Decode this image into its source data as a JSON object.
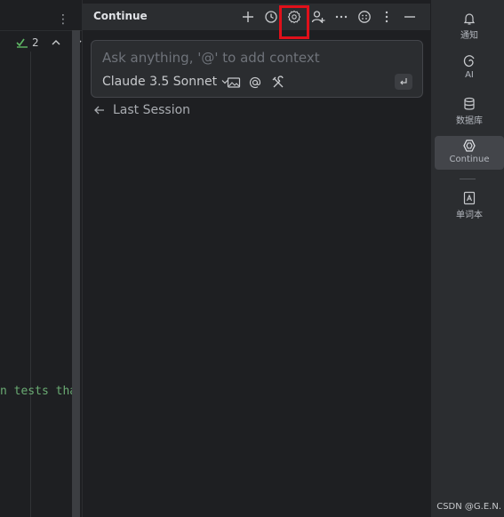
{
  "editor": {
    "kebab_icon": "more-vertical-icon",
    "inspection_count": "2",
    "code_snippet": "n tests tha",
    "colors": {
      "code_string": "#6aab73",
      "inspection_ok": "#5fb865"
    }
  },
  "panel": {
    "title": "Continue",
    "header_icons": [
      "plus-icon",
      "history-icon",
      "gear-icon",
      "person-add-icon",
      "ellipsis-icon",
      "emoji-icon",
      "more-vertical-icon",
      "minimize-icon"
    ],
    "highlight_color": "#e0101a",
    "input": {
      "placeholder": "Ask anything, '@' to add context",
      "model": "Claude 3.5 Sonnet",
      "icons": [
        "image-icon",
        "at-mention-icon",
        "tools-icon",
        "enter-icon"
      ]
    },
    "last_session_label": "Last Session"
  },
  "toolstrip": {
    "items": [
      {
        "label": "通知",
        "icon": "bell-icon",
        "active": false
      },
      {
        "label": "AI",
        "icon": "ai-spiral-icon",
        "active": false
      },
      {
        "label": "数据库",
        "icon": "database-icon",
        "active": false
      },
      {
        "label": "Continue",
        "icon": "continue-icon",
        "active": true
      },
      {
        "label": "单词本",
        "icon": "wordbook-icon",
        "active": false
      }
    ],
    "watermark": "CSDN @G.E.N."
  }
}
